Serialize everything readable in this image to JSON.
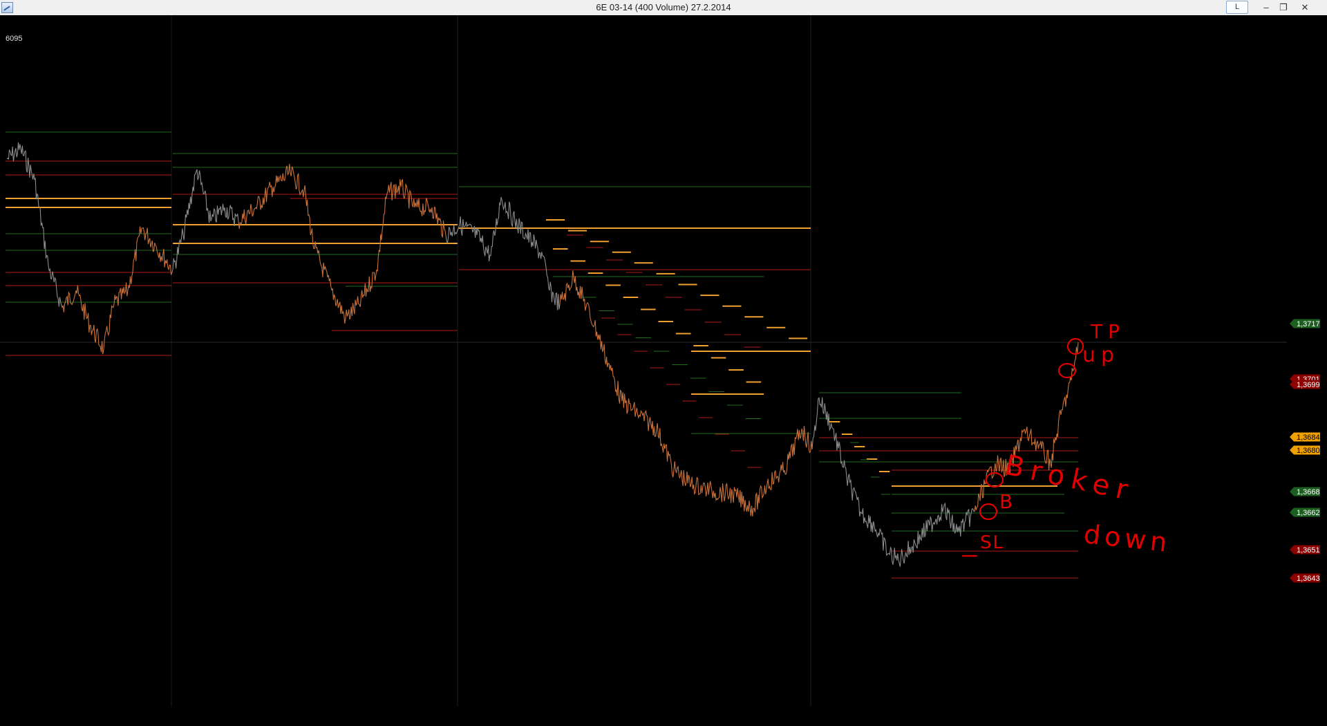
{
  "window": {
    "title": "6E 03-14 (400 Volume)  27.2.2014",
    "layout_label": "L",
    "minimize_glyph": "–",
    "restore_glyph": "❐",
    "close_glyph": "✕"
  },
  "colors": {
    "background": "#000000",
    "price_gray": "#8c8c8c",
    "price_orange": "#c8713a",
    "resistance": "#b01818",
    "support": "#1e6e1e",
    "pivot": "#f0a030",
    "annotation": "#e00000"
  },
  "chart_data": {
    "type": "line",
    "top_label": "6095",
    "y_axis": {
      "labels": [
        {
          "value": "1,3717",
          "kind": "support"
        },
        {
          "value": "1,3701",
          "kind": "resistance"
        },
        {
          "value": "1,3699",
          "kind": "resistance"
        },
        {
          "value": "1,3684",
          "kind": "pivot"
        },
        {
          "value": "1,3680",
          "kind": "pivot"
        },
        {
          "value": "1,3668",
          "kind": "support"
        },
        {
          "value": "1,3662",
          "kind": "support"
        },
        {
          "value": "1,3651",
          "kind": "resistance"
        },
        {
          "value": "1,3643",
          "kind": "resistance"
        }
      ]
    },
    "annotations": [
      "TP",
      "up",
      "Broker",
      "B",
      "down",
      "SL"
    ],
    "grid": "session separators"
  }
}
